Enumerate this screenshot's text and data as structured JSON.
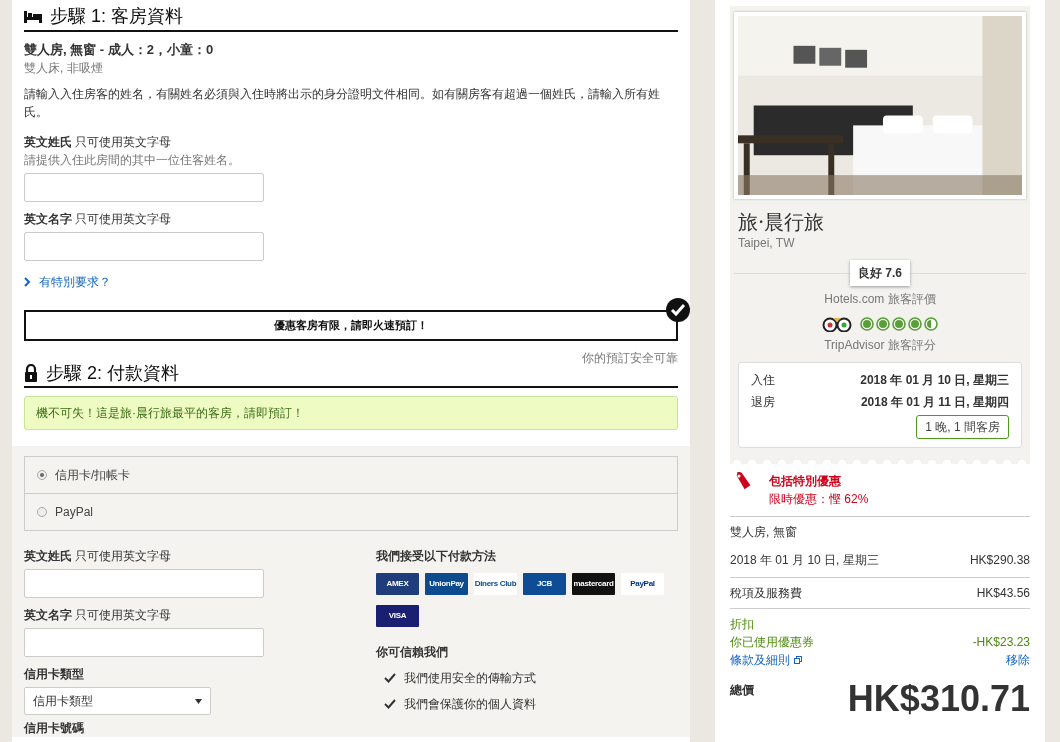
{
  "step1": {
    "title": "步驟 1: 客房資料",
    "room_title": "雙人房, 無窗 - 成人：2，小童：0",
    "room_detail": "雙人床, 非吸煙",
    "instructions": "請輸入入住房客的姓名，有關姓名必須與入住時將出示的身分證明文件相同。如有關房客有超過一個姓氏，請輸入所有姓氏。",
    "fields": [
      {
        "label": "英文姓氏",
        "hint": "只可使用英文字母",
        "helper": "請提供入住此房間的其中一位住客姓名。"
      },
      {
        "label": "英文名字",
        "hint": "只可使用英文字母"
      }
    ],
    "special_request": "有特別要求？"
  },
  "urgency": {
    "text": "優惠客房有限，請即火速預訂！",
    "checked": true
  },
  "step2": {
    "title": "步驟 2: 付款資料",
    "secure_note": "你的預訂安全可靠",
    "alert": "機不可失！這是旅·晨行旅最平的客房，請即預訂！",
    "payment_options": [
      {
        "label": "信用卡/扣帳卡",
        "selected": true
      },
      {
        "label": "PayPal",
        "selected": false
      }
    ],
    "fields": [
      {
        "label": "英文姓氏",
        "hint": "只可使用英文字母"
      },
      {
        "label": "英文名字",
        "hint": "只可使用英文字母"
      }
    ],
    "card_type": {
      "label": "信用卡類型",
      "value": "信用卡類型"
    },
    "card_number_label": "信用卡號碼",
    "accepted_title": "我們接受以下付款方法",
    "cards": [
      {
        "kind": "amex",
        "text": "AMEX"
      },
      {
        "kind": "unionpay",
        "text": "UnionPay"
      },
      {
        "kind": "diners",
        "text": "Diners Club"
      },
      {
        "kind": "jcb",
        "text": "JCB"
      },
      {
        "kind": "mastercard",
        "text": "mastercard"
      },
      {
        "kind": "paypal",
        "text": "PayPal"
      },
      {
        "kind": "visa",
        "text": "VISA"
      }
    ],
    "trust_title": "你可信賴我們",
    "trust_items": [
      "我們使用安全的傳輸方式",
      "我們會保護你的個人資料"
    ]
  },
  "sidebar": {
    "hotel_name": "旅·晨行旅",
    "location": "Taipei, TW",
    "rating": "良好 7.6",
    "rating_source": "Hotels.com 旅客評價",
    "tripadvisor": {
      "stars": 4.5,
      "label": "TripAdvisor 旅客評分"
    },
    "stay": [
      {
        "label": "入住",
        "value": "2018 年 01 月 10 日, 星期三"
      },
      {
        "label": "退房",
        "value": "2018 年 01 月 11 日, 星期四"
      }
    ],
    "nights": "1 晚, 1 間客房",
    "promo": {
      "title": "包括特別優惠",
      "subtitle": "限時優惠：慳 62%"
    },
    "room_name": "雙人房, 無窗",
    "lines": [
      {
        "label": "2018 年 01 月 10 日, 星期三",
        "amount": "HK$290.38"
      },
      {
        "label": "稅項及服務費",
        "amount": "HK$43.56"
      }
    ],
    "discount": {
      "label": "折扣",
      "coupon": "你已使用優惠券",
      "amount": "-HK$23.23",
      "terms": "條款及細則",
      "remove": "移除"
    },
    "total_label": "總價",
    "total": "HK$310.71"
  }
}
